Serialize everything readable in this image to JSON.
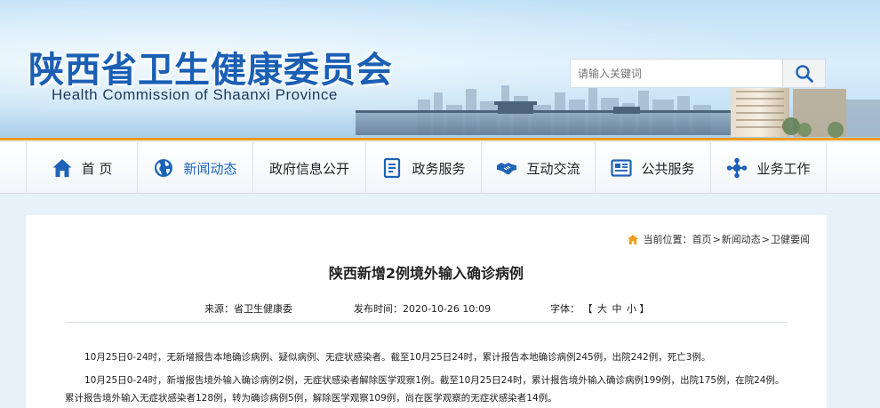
{
  "header": {
    "title": "陕西省卫生健康委员会",
    "subtitle": "Health Commission of Shaanxi Province",
    "search": {
      "placeholder": "请输入关键词",
      "icon": "search-icon"
    },
    "colors": {
      "title": "#1a5fb4",
      "stripe": "#f29c1f",
      "nav_active": "#1f63b8"
    }
  },
  "nav": {
    "items": [
      {
        "label": "首 页",
        "icon": "home-icon"
      },
      {
        "label": "新闻动态",
        "icon": "globe-icon"
      },
      {
        "label": "政府信息公开",
        "icon": ""
      },
      {
        "label": "政务服务",
        "icon": "document-icon"
      },
      {
        "label": "互动交流",
        "icon": "handshake-icon"
      },
      {
        "label": "公共服务",
        "icon": "newspaper-icon"
      },
      {
        "label": "业务工作",
        "icon": "network-icon"
      }
    ],
    "active_index": 1
  },
  "breadcrumb": {
    "prefix": "当前位置：",
    "items": [
      "首页",
      "新闻动态",
      "卫健要闻"
    ],
    "separator": " >"
  },
  "article": {
    "title": "陕西新增2例境外输入确诊病例",
    "source_label": "来源：",
    "source": "省卫生健康委",
    "date_label": "发布时间：",
    "date": "2020-10-26 10:09",
    "font_label": "字体：",
    "font_open": "【",
    "font_close": "】",
    "font_sizes": [
      "大",
      "中",
      "小"
    ],
    "paragraphs": [
      "10月25日0-24时，无新增报告本地确诊病例、疑似病例、无症状感染者。截至10月25日24时，累计报告本地确诊病例245例，出院242例，死亡3例。",
      "10月25日0-24时，新增报告境外输入确诊病例2例，无症状感染者解除医学观察1例。截至10月25日24时，累计报告境外输入确诊病例199例，出院175例，在院24例。累计报告境外输入无症状感染者128例，转为确诊病例5例，解除医学观察109例，尚在医学观察的无症状感染者14例。"
    ]
  }
}
